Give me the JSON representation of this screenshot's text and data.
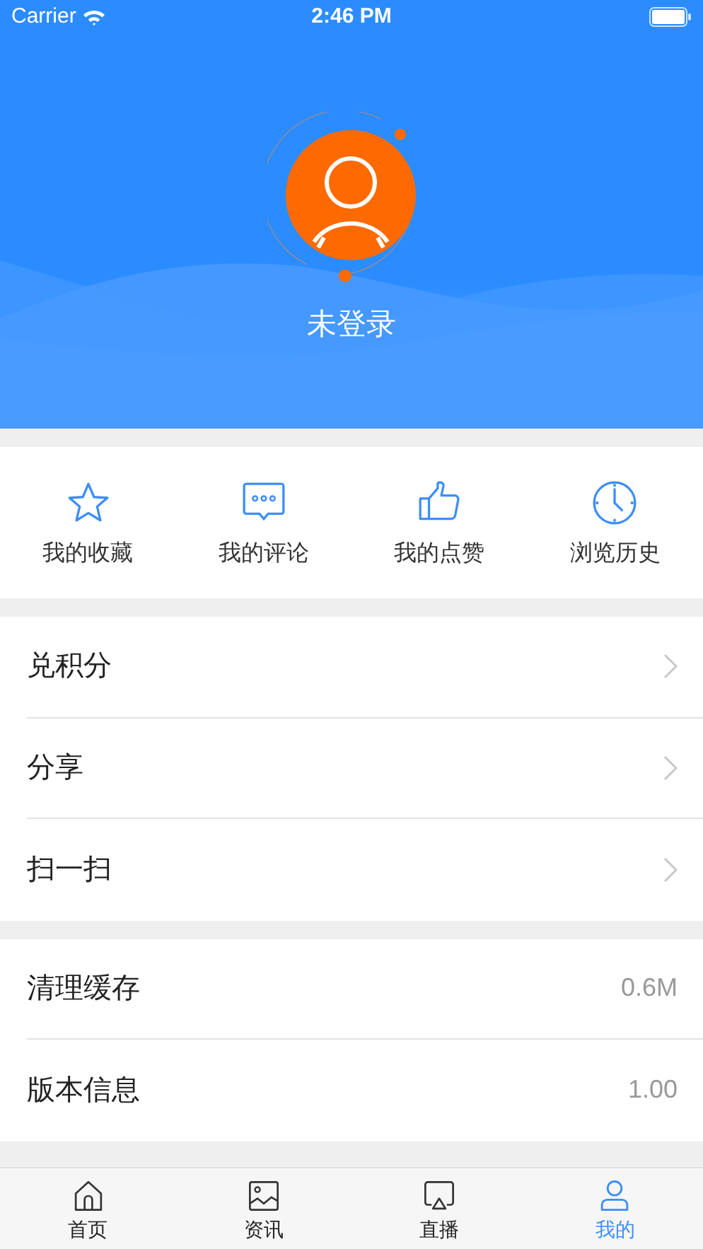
{
  "status_bar": {
    "carrier": "Carrier",
    "time": "2:46 PM"
  },
  "profile": {
    "name": "未登录"
  },
  "shortcuts": [
    {
      "kind": "star",
      "label": "我的收藏"
    },
    {
      "kind": "comment",
      "label": "我的评论"
    },
    {
      "kind": "thumb",
      "label": "我的点赞"
    },
    {
      "kind": "clock",
      "label": "浏览历史"
    }
  ],
  "menu_groups": [
    [
      {
        "kind": "link",
        "label": "兑积分"
      },
      {
        "kind": "link",
        "label": "分享"
      },
      {
        "kind": "link",
        "label": "扫一扫"
      }
    ],
    [
      {
        "kind": "value",
        "label": "清理缓存",
        "value": "0.6M"
      },
      {
        "kind": "value",
        "label": "版本信息",
        "value": "1.00"
      }
    ]
  ],
  "tab_bar": [
    {
      "kind": "home",
      "label": "首页",
      "selected": false
    },
    {
      "kind": "picture",
      "label": "资讯",
      "selected": false
    },
    {
      "kind": "screen",
      "label": "直播",
      "selected": false
    },
    {
      "kind": "person",
      "label": "我的",
      "selected": true
    }
  ]
}
